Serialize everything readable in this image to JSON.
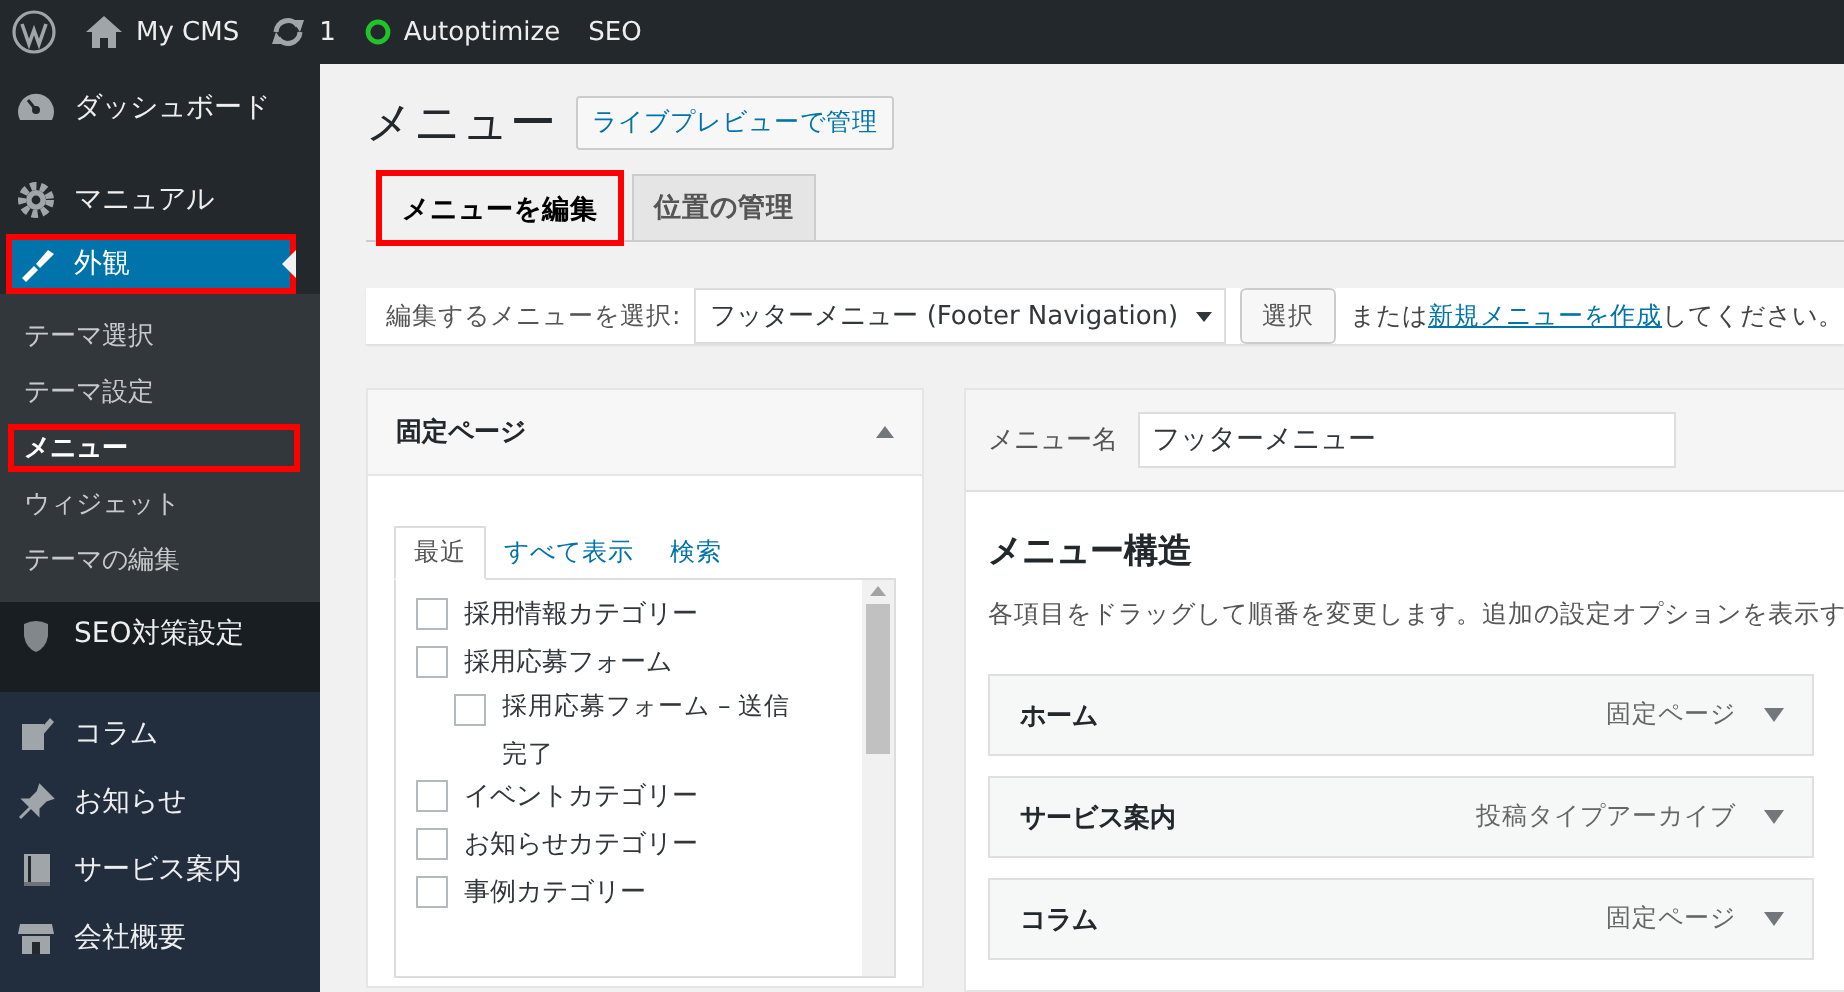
{
  "admin_bar": {
    "site": "My CMS",
    "updates": "1",
    "plugin": "Autoptimize",
    "seo": "SEO"
  },
  "sidebar": {
    "items": [
      {
        "label": "ダッシュボード",
        "selected": false,
        "highlighted": false
      },
      {
        "label": "マニュアル",
        "selected": false,
        "highlighted": false
      },
      {
        "label": "外観",
        "selected": true,
        "highlighted": true,
        "children": [
          {
            "label": "テーマ選択",
            "selected": false,
            "highlighted": false
          },
          {
            "label": "テーマ設定",
            "selected": false,
            "highlighted": false
          },
          {
            "label": "メニュー",
            "selected": true,
            "highlighted": true
          },
          {
            "label": "ウィジェット",
            "selected": false,
            "highlighted": false
          },
          {
            "label": "テーマの編集",
            "selected": false,
            "highlighted": false
          }
        ]
      },
      {
        "label": "SEO対策設定",
        "selected": false,
        "highlighted": false
      },
      {
        "label": "コラム",
        "selected": false,
        "highlighted": false
      },
      {
        "label": "お知らせ",
        "selected": false,
        "highlighted": false
      },
      {
        "label": "サービス案内",
        "selected": false,
        "highlighted": false
      },
      {
        "label": "会社概要",
        "selected": false,
        "highlighted": false
      }
    ]
  },
  "page": {
    "title": "メニュー",
    "preview_button": "ライブプレビューで管理"
  },
  "tabs": [
    {
      "label": "メニューを編集",
      "selected": true,
      "highlighted": true
    },
    {
      "label": "位置の管理",
      "selected": false,
      "highlighted": false
    }
  ],
  "menu_select": {
    "label": "編集するメニューを選択:",
    "value": "フッターメニュー (Footer Navigation)",
    "button": "選択",
    "note_before": "または",
    "note_link": "新規メニューを作成",
    "note_after": "してください。"
  },
  "pages_box": {
    "title": "固定ページ",
    "expanded": true,
    "tabs": [
      {
        "label": "最近",
        "selected": true
      },
      {
        "label": "すべて表示",
        "selected": false
      },
      {
        "label": "検索",
        "selected": false
      }
    ],
    "items": [
      {
        "label": "採用情報カテゴリー",
        "checked": false
      },
      {
        "label": "採用応募フォーム",
        "checked": false,
        "children": [
          {
            "label": "採用応募フォーム – 送信完了",
            "checked": false
          }
        ]
      },
      {
        "label": "イベントカテゴリー",
        "checked": false
      },
      {
        "label": "お知らせカテゴリー",
        "checked": false
      },
      {
        "label": "事例カテゴリー",
        "checked": false
      }
    ]
  },
  "menu_editor": {
    "name_label": "メニュー名",
    "name_value": "フッターメニュー",
    "heading": "メニュー構造",
    "description": "各項目をドラッグして順番を変更します。追加の設定オプションを表示す",
    "items": [
      {
        "title": "ホーム",
        "type": "固定ページ"
      },
      {
        "title": "サービス案内",
        "type": "投稿タイプアーカイブ"
      },
      {
        "title": "コラム",
        "type": "固定ページ"
      }
    ]
  }
}
